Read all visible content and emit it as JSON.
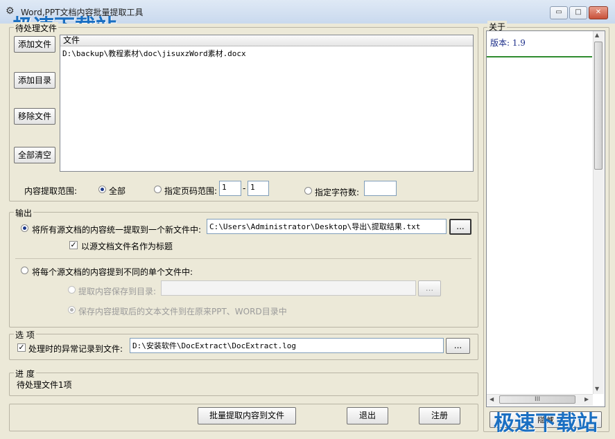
{
  "window": {
    "title": "Word,PPT文档内容批量提取工具",
    "watermark": "极速下载站"
  },
  "files": {
    "legend": "待处理文件",
    "add_file": "添加文件",
    "add_dir": "添加目录",
    "remove_file": "移除文件",
    "clear_all": "全部清空",
    "column_header": "文件",
    "items": [
      "D:\\backup\\教程素材\\doc\\jisuxzWord素材.docx"
    ]
  },
  "range": {
    "label": "内容提取范围:",
    "all": "全部",
    "page_range": "指定页码范围:",
    "page_from": "1",
    "dash": "-",
    "page_to": "1",
    "char_count": "指定字符数:",
    "char_value": ""
  },
  "output": {
    "legend": "输出",
    "merge_option": "将所有源文档的内容统一提取到一个新文件中:",
    "merge_path": "C:\\Users\\Administrator\\Desktop\\导出\\提取结果.txt",
    "browse": "...",
    "title_check": "以源文档文件名作为标题",
    "separate_option": "将每个源文档的内容提到不同的单个文件中:",
    "save_dir_option": "提取内容保存到目录:",
    "save_dir_value": "",
    "save_orig_option": "保存内容提取后的文本文件到在原来PPT、WORD目录中"
  },
  "options": {
    "legend": "选  项",
    "log_check": "处理时的异常记录到文件:",
    "log_path": "D:\\安装软件\\DocExtract\\DocExtract.log",
    "browse": "..."
  },
  "progress": {
    "legend": "进  度",
    "status": "待处理文件1项"
  },
  "actions": {
    "extract": "批量提取内容到文件",
    "exit": "退出",
    "register": "注册"
  },
  "about": {
    "legend": "关于",
    "version": "版本: 1.9",
    "hide": "隐藏",
    "hscroll_glyph": "III"
  },
  "colors": {
    "version_text": "#1d2f8a",
    "green_rule": "#2e8b2e"
  }
}
